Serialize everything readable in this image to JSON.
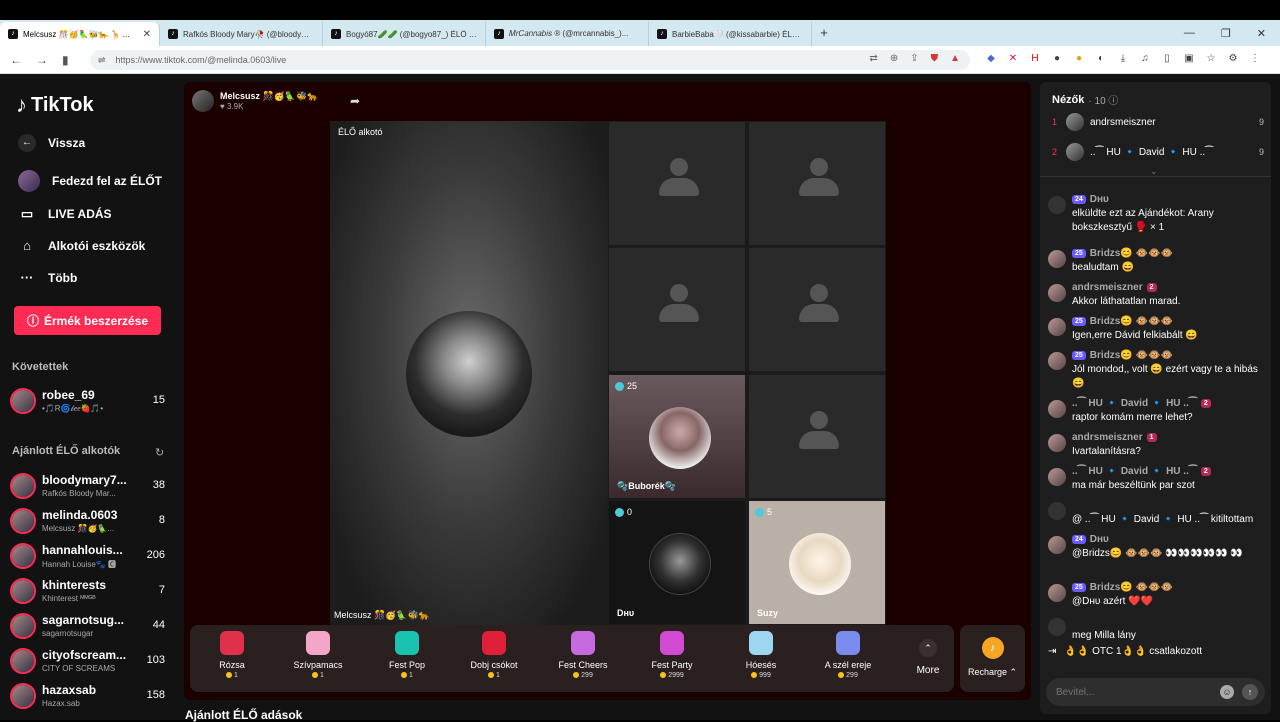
{
  "browser": {
    "tabs": [
      {
        "label": "Melcsusz 🎊🥳🦜🐝🐆 🦒 ...",
        "active": true
      },
      {
        "label": "Rafkós Bloody Mary🥀 (@bloodymar..."
      },
      {
        "label": "Bogyó87🥒🥒 (@bogyo87_) ÉLŐ a..."
      },
      {
        "label": "𝑀𝑟𝐶𝑎𝑛𝑛𝑎𝑏𝑖𝑠 ® (@mrcannabis_)..."
      },
      {
        "label": "BarbieBaba🤍 (@kissabarbie) ÉLŐ a..."
      }
    ],
    "url": "https://www.tiktok.com/@melinda.0603/live"
  },
  "sidebar": {
    "logo": "TikTok",
    "nav": {
      "back": "Vissza",
      "explore": "Fedezd fel az ÉLŐT",
      "live": "LIVE ADÁS",
      "creator_tools": "Alkotói eszközök",
      "more": "Több"
    },
    "buy_coins": "Érmék beszerzése",
    "following_title": "Követettek",
    "following": [
      {
        "name": "robee_69",
        "sub": "•🎵R🌀𝒷𝑒𝑒🍓🎵•",
        "count": "15"
      }
    ],
    "recommended_title": "Ajánlott ÉLŐ alkotók",
    "recommended": [
      {
        "name": "bloodymary7...",
        "sub": "Rafkós Bloody Mar...",
        "count": "38"
      },
      {
        "name": "melinda.0603",
        "sub": "Melcsusz 🎊🥳🦜...",
        "count": "8"
      },
      {
        "name": "hannahlouis...",
        "sub": "Hannah Louise🐾 🅲",
        "count": "206"
      },
      {
        "name": "khinterests",
        "sub": "Khinterest ᴹᴹᴳᴮ",
        "count": "7"
      },
      {
        "name": "sagarnotsug...",
        "sub": "sagarnotsugar",
        "count": "44"
      },
      {
        "name": "cityofscream...",
        "sub": "CITY OF SCREAMS",
        "count": "103"
      },
      {
        "name": "hazaxsab",
        "sub": "Hazax.sab",
        "count": "158"
      }
    ]
  },
  "stream": {
    "host_name": "Melcsusz 🎊🥳🦜🐝🐆",
    "host_likes": "♥ 3.9K",
    "big_label": "ÉLŐ alkotó",
    "big_name": "Melcsusz 🎊🥳🦜🐝🐆",
    "guests": [
      {
        "name": "🫧Buborék🫧",
        "score": "25"
      },
      {
        "name": "Dʜᴜ",
        "score": "0"
      },
      {
        "name": "Suzy",
        "score": "5"
      }
    ]
  },
  "gifts": [
    {
      "name": "Rózsa",
      "price": "1",
      "color": "#e0304a"
    },
    {
      "name": "Szívpamacs",
      "price": "1",
      "color": "#f4a6c8"
    },
    {
      "name": "Fest Pop",
      "price": "1",
      "color": "#19c3b0"
    },
    {
      "name": "Dobj csókot",
      "price": "1",
      "color": "#e0203a"
    },
    {
      "name": "Fest Cheers",
      "price": "299",
      "color": "#c86adf"
    },
    {
      "name": "Fest Party",
      "price": "2999",
      "color": "#d24ad0"
    },
    {
      "name": "Hóesés",
      "price": "999",
      "color": "#9ed6f0"
    },
    {
      "name": "A szél ereje",
      "price": "299",
      "color": "#7a8cf0"
    }
  ],
  "more_label": "More",
  "recharge_label": "Recharge ⌃",
  "bottom_title": "Ajánlott ÉLŐ adások",
  "chat": {
    "viewers_label": "Nézők",
    "viewers_count": "· 10 ⓘ",
    "top_viewers": [
      {
        "rank": "1",
        "name": "andrsmeiszner",
        "score": "9"
      },
      {
        "rank": "2",
        "name": "..⁀ HU 🔹 David 🔹 HU ..⁀",
        "score": "9"
      }
    ],
    "messages": [
      {
        "head": "Dʜᴜ",
        "badge": "24",
        "text": "elküldte ezt az Ajándékot: Arany bokszkesztyű 🥊 × 1"
      },
      {
        "head": "Bridzs😊 🐵🐵🐵",
        "badge": "25",
        "text": "bealudtam 😄"
      },
      {
        "head": "andrsmeiszner",
        "badge": "2",
        "text": "Akkor láthatatlan marad."
      },
      {
        "head": "Bridzs😊 🐵🐵🐵",
        "badge": "25",
        "text": "Igen,erre Dávid felkiabált 😄"
      },
      {
        "head": "Bridzs😊 🐵🐵🐵",
        "badge": "25",
        "text": "Jól mondod,, volt 😄 ezért vagy te a hibás 😄"
      },
      {
        "head": "..⁀ HU 🔹 David 🔹 HU ..⁀",
        "badge": "2",
        "text": "raptor komám merre lehet?"
      },
      {
        "head": "andrsmeiszner",
        "badge": "1",
        "text": "Ivartalanításra?"
      },
      {
        "head": "..⁀ HU 🔹 David 🔹 HU ..⁀",
        "badge": "2",
        "text": "ma már beszéltünk par szot"
      },
      {
        "head": "",
        "badge": "",
        "text": "@ ..⁀ HU 🔹 David 🔹 HU ..⁀ kitiltottam"
      },
      {
        "head": "Dʜᴜ",
        "badge": "24",
        "text": "@Bridzs😊 🐵🐵🐵 👀👀👀👀👀 👀"
      },
      {
        "head": "Bridzs😊 🐵🐵🐵",
        "badge": "25",
        "text": "@Dʜᴜ azért ❤️❤️"
      },
      {
        "head": "",
        "badge": "",
        "text": "meg Milla lány"
      }
    ],
    "join_text": "👌👌 OTC 1👌👌  csatlakozott",
    "input_placeholder": "Bevitel..."
  }
}
